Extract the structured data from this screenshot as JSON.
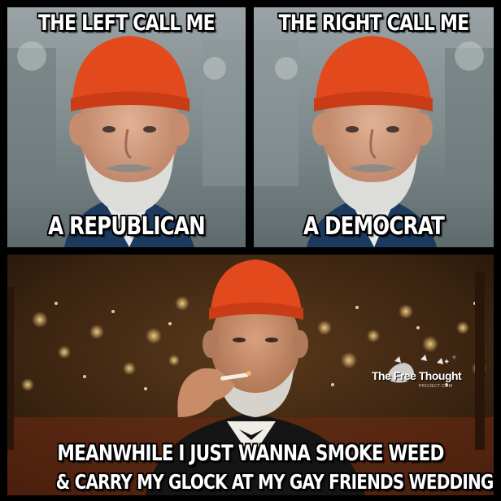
{
  "meme": {
    "panel_left": {
      "caption_top": "THE LEFT CALL ME",
      "caption_bottom": "A REPUBLICAN"
    },
    "panel_right": {
      "caption_top": "THE RIGHT CALL ME",
      "caption_bottom": "A DEMOCRAT"
    },
    "panel_bottom": {
      "caption_line1": "MEANWHILE I JUST WANNA SMOKE WEED",
      "caption_line2": "& CARRY MY GLOCK AT MY GAY FRIENDS WEDDING"
    },
    "watermark": {
      "brand": "The Free Thought",
      "sub": "PROJECT.COM"
    }
  },
  "colors": {
    "beanie": "#e24a1e",
    "caption_text": "#ffffff",
    "caption_outline": "#000000",
    "background": "#000000"
  }
}
